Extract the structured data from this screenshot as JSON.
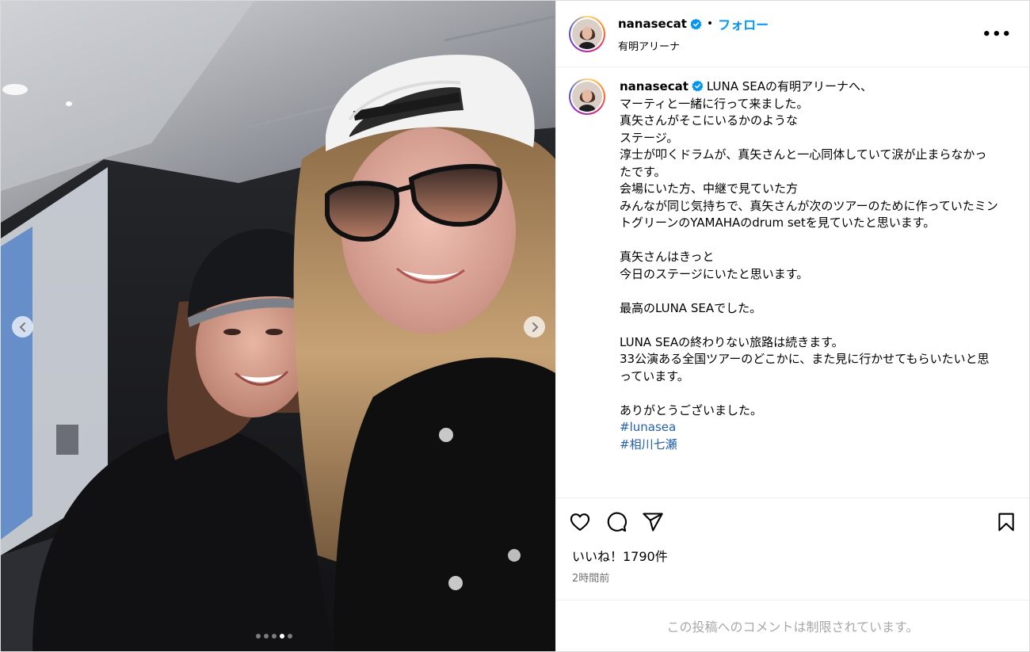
{
  "post": {
    "username": "nanasecat",
    "follow_label": "フォロー",
    "separator": "•",
    "location": "有明アリーナ",
    "more_label": "•••",
    "caption_user": "nanasecat",
    "caption_text": "LUNA SEAの有明アリーナへ、\nマーティと一緒に行って来ました。\n真矢さんがそこにいるかのような\nステージ。\n淳士が叩くドラムが、真矢さんと一心同体していて涙が止まらなかったです。\n会場にいた方、中継で見ていた方\nみんなが同じ気持ちで、真矢さんが次のツアーのために作っていたミントグリーンのYAMAHAのdrum setを見ていたと思います。\n\n真矢さんはきっと\n今日のステージにいたと思います。\n\n最高のLUNA SEAでした。\n\nLUNA SEAの終わりない旅路は続きます。\n33公演ある全国ツアーのどこかに、また見に行かせてもらいたいと思っています。\n\nありがとうございました。\n",
    "hashtags": [
      "#lunasea",
      "#相川七瀬"
    ],
    "likes_label": "いいね！1790件",
    "time_ago": "2時間前",
    "comments_disabled": "この投稿へのコメントは制限されています。"
  },
  "carousel": {
    "total": 5,
    "active_index": 3
  },
  "icons": {
    "verified": "verified-badge-icon",
    "like": "heart-icon",
    "comment": "comment-icon",
    "share": "share-icon",
    "save": "bookmark-icon",
    "prev": "chevron-left-icon",
    "next": "chevron-right-icon"
  },
  "colors": {
    "link_blue": "#0095f6",
    "verified_blue": "#0095f6",
    "hashtag": "#2561a8",
    "muted": "#737373"
  }
}
